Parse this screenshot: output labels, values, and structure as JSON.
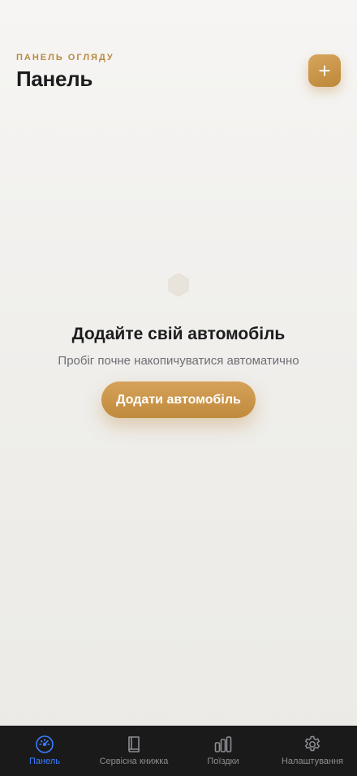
{
  "header": {
    "eyebrow": "ПАНЕЛЬ ОГЛЯДУ",
    "title": "Панель",
    "add_icon": "plus-icon",
    "add_glyph": "+"
  },
  "empty_state": {
    "icon": "hexagon-icon",
    "title": "Додайте свій автомобіль",
    "subtitle": "Пробіг почне накопичуватися автоматично",
    "button_label": "Додати автомобіль"
  },
  "tabbar": {
    "items": [
      {
        "label": "Панель",
        "icon": "speedometer-icon",
        "active": true
      },
      {
        "label": "Сервісна книжка",
        "icon": "book-icon",
        "active": false
      },
      {
        "label": "Поїздки",
        "icon": "bars-icon",
        "active": false
      },
      {
        "label": "Налаштування",
        "icon": "gear-icon",
        "active": false
      }
    ]
  },
  "colors": {
    "accent": "#c38e42",
    "active_tab": "#3d7dff",
    "tabbar_bg": "#1a1a1a",
    "background": "#f2f1ee"
  }
}
